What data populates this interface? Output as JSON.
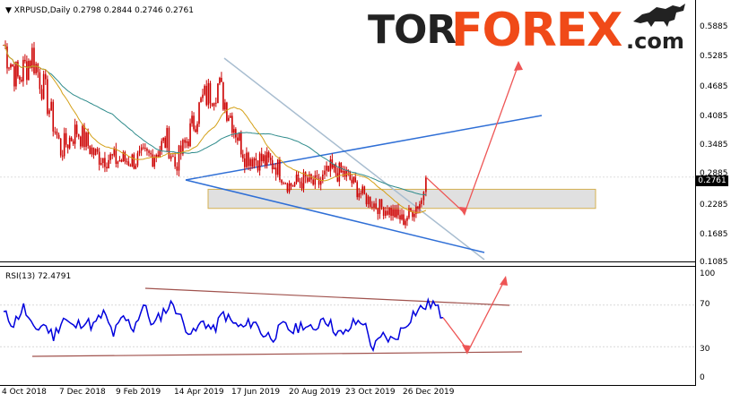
{
  "chart_header": {
    "symbol": "XRPUSD,Daily",
    "ohlc": "0.2798 0.2844 0.2746 0.2761"
  },
  "logo": {
    "part1": "TOR",
    "part2": "FOREX",
    "part3": ".com",
    "icon": "bull-icon"
  },
  "current_price": "0.2761",
  "rsi_header": "RSI(13) 72.4791",
  "colors": {
    "candles": "#cc0000",
    "ma_slow": "#2e8b8b",
    "ma_fast": "#d4a017",
    "rsi": "#0000dd",
    "trend_blue": "#2f6fd6",
    "trend_grey": "#a8bdd0",
    "arrow": "#ee5555",
    "box": "#d8d8d8"
  },
  "chart_data": [
    {
      "type": "line",
      "title": "XRPUSD,Daily",
      "x_ticks": [
        "4 Oct 2018",
        "7 Dec 2018",
        "9 Feb 2019",
        "14 Apr 2019",
        "17 Jun 2019",
        "20 Aug 2019",
        "23 Oct 2019",
        "26 Dec 2019"
      ],
      "y_ticks": [
        "0.5885",
        "0.5285",
        "0.4685",
        "0.4085",
        "0.3485",
        "0.2885",
        "0.2285",
        "0.1685",
        "0.1085"
      ],
      "ylim": [
        0.1085,
        0.6285
      ],
      "series": [
        {
          "name": "",
          "x": [
            "2018-10-04",
            "2018-10-20",
            "2018-11-05",
            "2018-11-20",
            "2018-12-07",
            "2018-12-25",
            "2019-01-15",
            "2019-02-09",
            "2019-03-01",
            "2019-03-20",
            "2019-04-05",
            "2019-04-14",
            "2019-04-25",
            "2019-05-15",
            "2019-06-01",
            "2019-06-17",
            "2019-07-01",
            "2019-07-20",
            "2019-08-05",
            "2019-08-20",
            "2019-09-05",
            "2019-09-20",
            "2019-10-05",
            "2019-10-23",
            "2019-11-10",
            "2019-11-25",
            "2019-12-10",
            "2019-12-26",
            "2020-01-05",
            "2020-01-15",
            "2020-01-20"
          ],
          "values": [
            0.54,
            0.47,
            0.52,
            0.44,
            0.33,
            0.37,
            0.32,
            0.31,
            0.31,
            0.32,
            0.35,
            0.3,
            0.34,
            0.43,
            0.46,
            0.39,
            0.32,
            0.31,
            0.3,
            0.26,
            0.27,
            0.26,
            0.29,
            0.28,
            0.24,
            0.22,
            0.21,
            0.19,
            0.21,
            0.23,
            0.276
          ]
        }
      ]
    },
    {
      "type": "line",
      "title": "RSI(13) 72.4791",
      "y_ticks": [
        "100",
        "70",
        "30",
        "0"
      ],
      "ylim": [
        0,
        100
      ],
      "series": [
        {
          "name": "",
          "values": [
            62,
            52,
            68,
            45,
            52,
            40,
            58,
            48,
            55,
            50,
            62,
            42,
            58,
            48,
            70,
            50,
            64,
            72,
            52,
            42,
            55,
            45,
            62,
            52,
            48,
            55,
            42,
            40,
            50,
            45,
            52,
            44,
            60,
            48,
            40,
            52,
            55,
            28,
            40,
            36,
            48,
            62,
            68,
            72,
            58
          ]
        }
      ]
    }
  ]
}
